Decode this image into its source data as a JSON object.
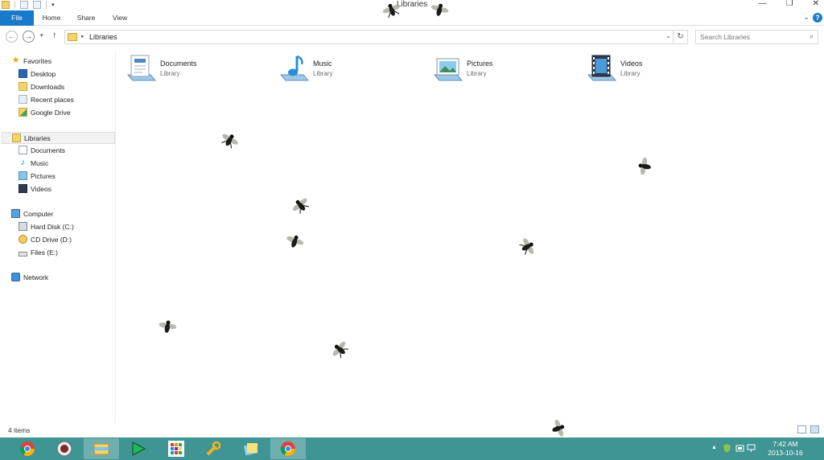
{
  "window": {
    "title": "Libraries",
    "controls": {
      "minimize": "—",
      "maximize": "❐",
      "close": "✕"
    }
  },
  "ribbon": {
    "tabs": [
      {
        "label": "File"
      },
      {
        "label": "Home"
      },
      {
        "label": "Share"
      },
      {
        "label": "View"
      }
    ],
    "expand": "⌄",
    "help": "?"
  },
  "navigation": {
    "back": "←",
    "forward": "→",
    "recent_dropdown": "▾",
    "up": "↑",
    "breadcrumb_separator": "▸",
    "breadcrumb": "Libraries",
    "address_dropdown": "⌄",
    "refresh": "↻",
    "search_placeholder": "Search Libraries",
    "search_icon": "⌕"
  },
  "nav_pane": {
    "favorites_label": "Favorites",
    "favorites": [
      "Desktop",
      "Downloads",
      "Recent places",
      "Google Drive"
    ],
    "libraries_label": "Libraries",
    "libraries": [
      "Documents",
      "Music",
      "Pictures",
      "Videos"
    ],
    "computer_label": "Computer",
    "drives": [
      "Hard Disk (C:)",
      "CD Drive (D:)",
      "Files (E:)"
    ],
    "network_label": "Network"
  },
  "content": {
    "items": [
      {
        "name": "Documents",
        "type": "Library",
        "icon": "documents-library-icon"
      },
      {
        "name": "Music",
        "type": "Library",
        "icon": "music-library-icon"
      },
      {
        "name": "Pictures",
        "type": "Library",
        "icon": "pictures-library-icon"
      },
      {
        "name": "Videos",
        "type": "Library",
        "icon": "videos-library-icon"
      }
    ]
  },
  "status": {
    "item_count": "4 items"
  },
  "taskbar": {
    "apps": [
      "chrome-icon",
      "winamp-icon",
      "file-explorer-icon",
      "play-arrow-icon",
      "grid-app-icon",
      "tools-icon",
      "sticky-notes-icon",
      "chrome-icon"
    ],
    "active_app": "file-explorer-icon",
    "tray": {
      "show_hidden": "▲",
      "time": "7:42 AM",
      "date": "2013-10-16"
    }
  },
  "colors": {
    "file_tab": "#1979ca",
    "taskbar": "#3f9494",
    "selected_nav": "#f2f2f2"
  }
}
